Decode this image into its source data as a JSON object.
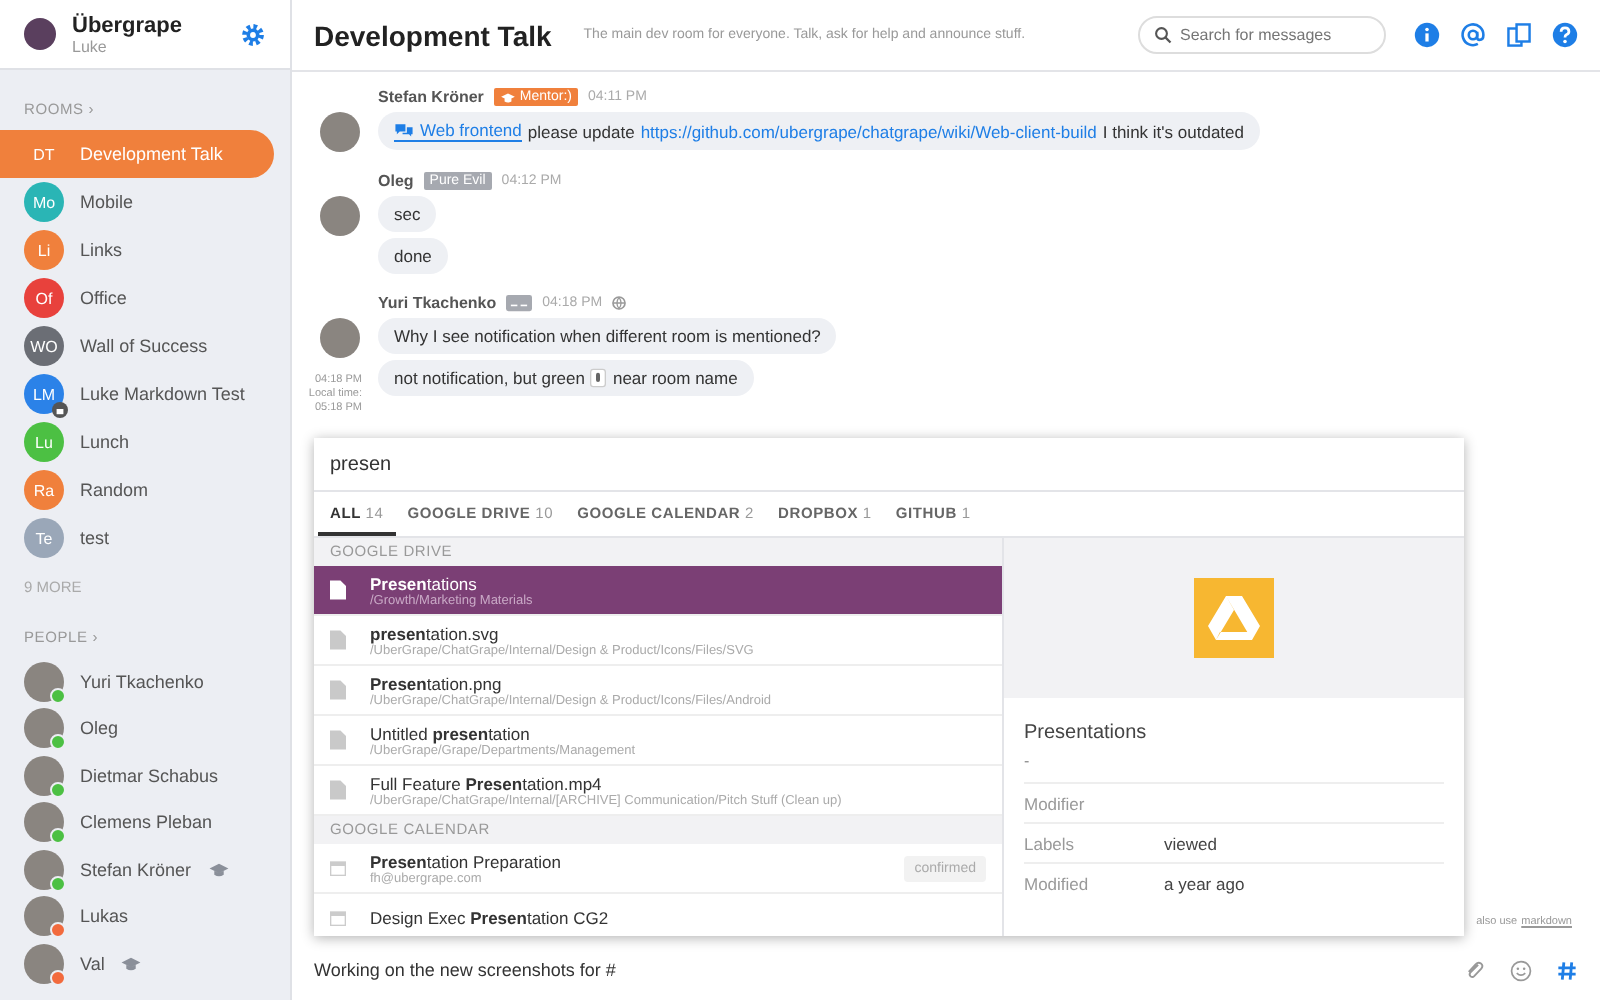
{
  "org": {
    "name": "Übergrape",
    "user": "Luke"
  },
  "rooms_heading": "ROOMS ›",
  "rooms": [
    {
      "initials": "DT",
      "name": "Development Talk",
      "color": "#f0803c",
      "selected": true,
      "locked": false
    },
    {
      "initials": "Mo",
      "name": "Mobile",
      "color": "#2ab5b5",
      "selected": false,
      "locked": false
    },
    {
      "initials": "Li",
      "name": "Links",
      "color": "#f0803c",
      "selected": false,
      "locked": false
    },
    {
      "initials": "Of",
      "name": "Office",
      "color": "#e8413c",
      "selected": false,
      "locked": false
    },
    {
      "initials": "WO",
      "name": "Wall of Success",
      "color": "#6b6e75",
      "selected": false,
      "locked": false
    },
    {
      "initials": "LM",
      "name": "Luke Markdown Test",
      "color": "#2b82e8",
      "selected": false,
      "locked": true
    },
    {
      "initials": "Lu",
      "name": "Lunch",
      "color": "#4cc043",
      "selected": false,
      "locked": false
    },
    {
      "initials": "Ra",
      "name": "Random",
      "color": "#f0803c",
      "selected": false,
      "locked": false
    },
    {
      "initials": "Te",
      "name": "test",
      "color": "#9aa7b8",
      "selected": false,
      "locked": false
    }
  ],
  "rooms_more": "9 MORE",
  "people_heading": "PEOPLE ›",
  "people": [
    {
      "name": "Yuri Tkachenko",
      "online": true,
      "mentor": false
    },
    {
      "name": "Oleg",
      "online": true,
      "mentor": false
    },
    {
      "name": "Dietmar Schabus",
      "online": true,
      "mentor": false
    },
    {
      "name": "Clemens Pleban",
      "online": true,
      "mentor": false
    },
    {
      "name": "Stefan Kröner",
      "online": true,
      "mentor": true
    },
    {
      "name": "Lukas",
      "online": false,
      "mentor": false
    },
    {
      "name": "Val",
      "online": false,
      "mentor": true
    }
  ],
  "header": {
    "title": "Development Talk",
    "description": "The main dev room for everyone. Talk, ask for help and announce stuff.",
    "search_placeholder": "Search for messages"
  },
  "messages": [
    {
      "author": "Stefan Kröner",
      "badge": {
        "kind": "mentor",
        "text": "Mentor:)"
      },
      "time": "04:11 PM",
      "bubbles": [
        [
          {
            "kind": "room",
            "text": "Web frontend"
          },
          {
            "kind": "text",
            "text": "please update"
          },
          {
            "kind": "link",
            "text": "https://github.com/ubergrape/chatgrape/wiki/Web-client-build"
          },
          {
            "kind": "text",
            "text": "I think it's outdated"
          }
        ]
      ]
    },
    {
      "author": "Oleg",
      "badge": {
        "kind": "role",
        "text": "Pure Evil"
      },
      "time": "04:12 PM",
      "bubbles": [
        [
          {
            "kind": "text",
            "text": "sec"
          }
        ],
        [
          {
            "kind": "text",
            "text": "done"
          }
        ]
      ]
    },
    {
      "author": "Yuri Tkachenko",
      "badge": {
        "kind": "icon"
      },
      "time": "04:18 PM",
      "local_time": [
        "04:18 PM",
        "Local time:",
        "05:18 PM"
      ],
      "bubbles": [
        [
          {
            "kind": "text",
            "text": "Why I see notification when different room is mentioned?"
          }
        ],
        [
          {
            "kind": "text",
            "text": "not notification, but green"
          },
          {
            "kind": "icon"
          },
          {
            "kind": "text",
            "text": "near room name"
          }
        ]
      ]
    }
  ],
  "search": {
    "query": "presen",
    "tabs": [
      {
        "label": "ALL",
        "count": "14",
        "selected": true
      },
      {
        "label": "GOOGLE DRIVE",
        "count": "10",
        "selected": false
      },
      {
        "label": "GOOGLE CALENDAR",
        "count": "2",
        "selected": false
      },
      {
        "label": "DROPBOX",
        "count": "1",
        "selected": false
      },
      {
        "label": "GITHUB",
        "count": "1",
        "selected": false
      }
    ],
    "sections": [
      {
        "heading": "GOOGLE DRIVE",
        "results": [
          {
            "kind": "file",
            "title": "**Presen**tations",
            "subtitle": "/Growth/Marketing Materials",
            "selected": true
          },
          {
            "kind": "file",
            "title": "**presen**tation.svg",
            "subtitle": "/UberGrape/ChatGrape/Internal/Design & Product/Icons/Files/SVG",
            "selected": false
          },
          {
            "kind": "file",
            "title": "**Presen**tation.png",
            "subtitle": "/UberGrape/ChatGrape/Internal/Design & Product/Icons/Files/Android",
            "selected": false
          },
          {
            "kind": "file",
            "title": "Untitled **presen**tation",
            "subtitle": "/UberGrape/Grape/Departments/Management",
            "selected": false
          },
          {
            "kind": "file",
            "title": "Full Feature **Presen**tation.mp4",
            "subtitle": "/UberGrape/ChatGrape/Internal/[ARCHIVE] Communication/Pitch Stuff (Clean up)",
            "selected": false
          }
        ]
      },
      {
        "heading": "GOOGLE CALENDAR",
        "results": [
          {
            "kind": "event",
            "title": "**Presen**tation Preparation",
            "subtitle": "fh@ubergrape.com",
            "status": "confirmed",
            "selected": false
          },
          {
            "kind": "event",
            "title": "Design Exec **Presen**tation CG2",
            "selected": false
          }
        ]
      }
    ],
    "detail": {
      "title": "Presentations",
      "description": "-",
      "fields": [
        {
          "label": "Modifier"
        },
        {
          "label": "Labels",
          "value": "viewed"
        },
        {
          "label": "Modified",
          "value": "a year ago"
        }
      ]
    }
  },
  "composer": {
    "value": "Working on the new screenshots for #",
    "hint": "also use",
    "hint_link": "markdown"
  }
}
